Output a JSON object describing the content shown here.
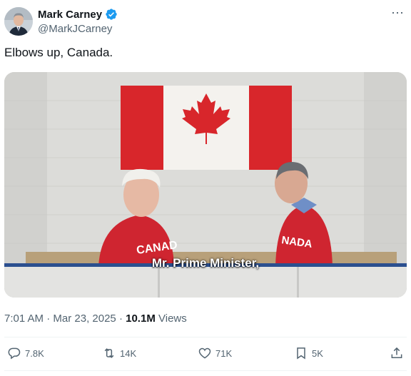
{
  "author": {
    "name": "Mark Carney",
    "handle": "@MarkJCarney",
    "verified_color": "#1d9bf0"
  },
  "tweet": {
    "text": "Elbows up, Canada."
  },
  "video": {
    "caption": "Mr. Prime Minister,",
    "sweater_text_left": "CANAD",
    "sweater_text_right": "NADA"
  },
  "meta": {
    "time": "7:01 AM",
    "separator": "·",
    "date": "Mar 23, 2025",
    "views_count": "10.1M",
    "views_label": "Views"
  },
  "actions": {
    "replies": "7.8K",
    "reposts": "14K",
    "likes": "71K",
    "bookmarks": "5K"
  },
  "icons": {
    "more": "more-icon",
    "reply": "reply-icon",
    "repost": "repost-icon",
    "like": "heart-icon",
    "bookmark": "bookmark-icon",
    "share": "share-icon"
  }
}
